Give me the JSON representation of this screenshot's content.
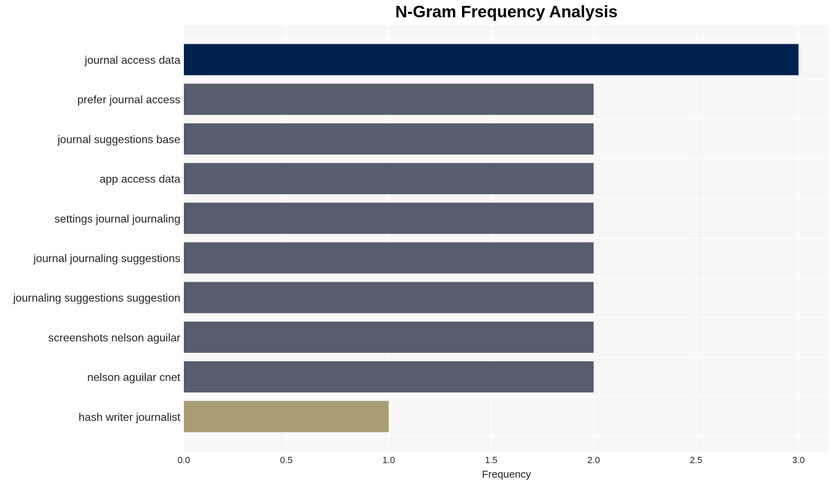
{
  "chart_data": {
    "type": "bar",
    "orientation": "horizontal",
    "title": "N-Gram Frequency Analysis",
    "xlabel": "Frequency",
    "ylabel": "",
    "xlim": [
      0,
      3.15
    ],
    "xticks": [
      0.0,
      0.5,
      1.0,
      1.5,
      2.0,
      2.5,
      3.0
    ],
    "xtick_labels": [
      "0.0",
      "0.5",
      "1.0",
      "1.5",
      "2.0",
      "2.5",
      "3.0"
    ],
    "grid": true,
    "legend": "none",
    "categories": [
      "journal access data",
      "prefer journal access",
      "journal suggestions base",
      "app access data",
      "settings journal journaling",
      "journal journaling suggestions",
      "journaling suggestions suggestion",
      "screenshots nelson aguilar",
      "nelson aguilar cnet",
      "hash writer journalist"
    ],
    "values": [
      3,
      2,
      2,
      2,
      2,
      2,
      2,
      2,
      2,
      1
    ],
    "colors": [
      "#00224e",
      "#575d6d",
      "#575d6d",
      "#575d6d",
      "#575d6d",
      "#575d6d",
      "#575d6d",
      "#575d6d",
      "#575d6d",
      "#a69d75"
    ]
  },
  "colors": {
    "plot_background": "#f7f7f7",
    "gridline": "#ffffff"
  }
}
